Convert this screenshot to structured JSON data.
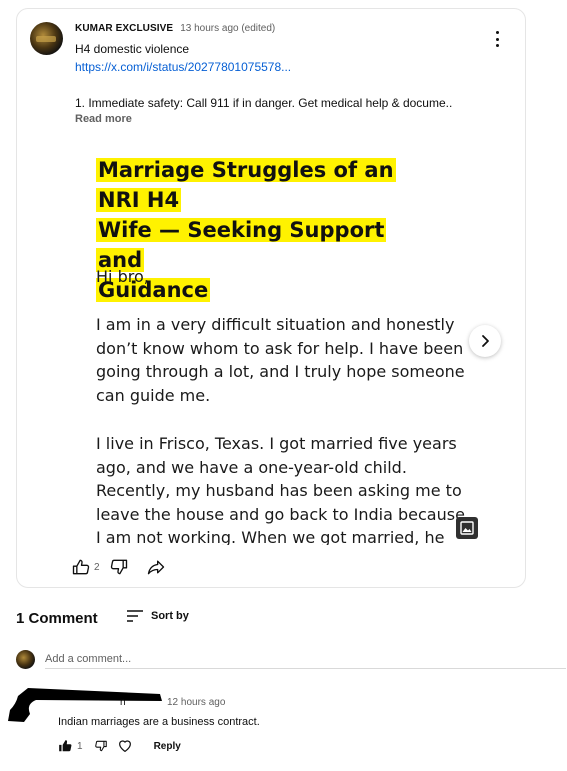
{
  "post": {
    "author": "KUMAR EXCLUSIVE",
    "timestamp": "13 hours ago (edited)",
    "title": "H4 domestic violence",
    "link_text": "https://x.com/i/status/20277801075578...",
    "body_preview": "1. Immediate safety: Call 911 if in danger. Get medical help & docume..",
    "read_more_label": "Read more",
    "image": {
      "title_line1": "Marriage Struggles of an NRI H4",
      "title_line2": "Wife — Seeking Support and",
      "title_line3": "Guidance",
      "greeting": "Hi bro,",
      "para1": "I am in a very difficult situation and honestly don’t know whom to ask for help. I have been going through a lot, and I truly hope someone can guide me.",
      "para2": "I live in Frisco, Texas. I got married five years ago, and we have a one-year-old child. Recently, my husband has been asking me to leave the house and go back to India because I am not working. When we got married, he"
    },
    "like_count": "2",
    "icons": {
      "menu": "more-vert-icon",
      "next": "chevron-right-icon",
      "badge": "image-icon",
      "like": "thumb-up-icon",
      "dislike": "thumb-down-icon",
      "share": "share-icon"
    }
  },
  "comments": {
    "count_label": "1 Comment",
    "sort_label": "Sort by",
    "input_placeholder": "Add a comment...",
    "items": [
      {
        "author": "n",
        "timestamp": "12 hours ago",
        "text": "Indian marriages are a business contract.",
        "like_count": "1",
        "reply_label": "Reply"
      }
    ]
  },
  "colors": {
    "link": "#065fd4",
    "highlight": "#fff200",
    "muted": "#606060",
    "text": "#0f0f0f"
  }
}
